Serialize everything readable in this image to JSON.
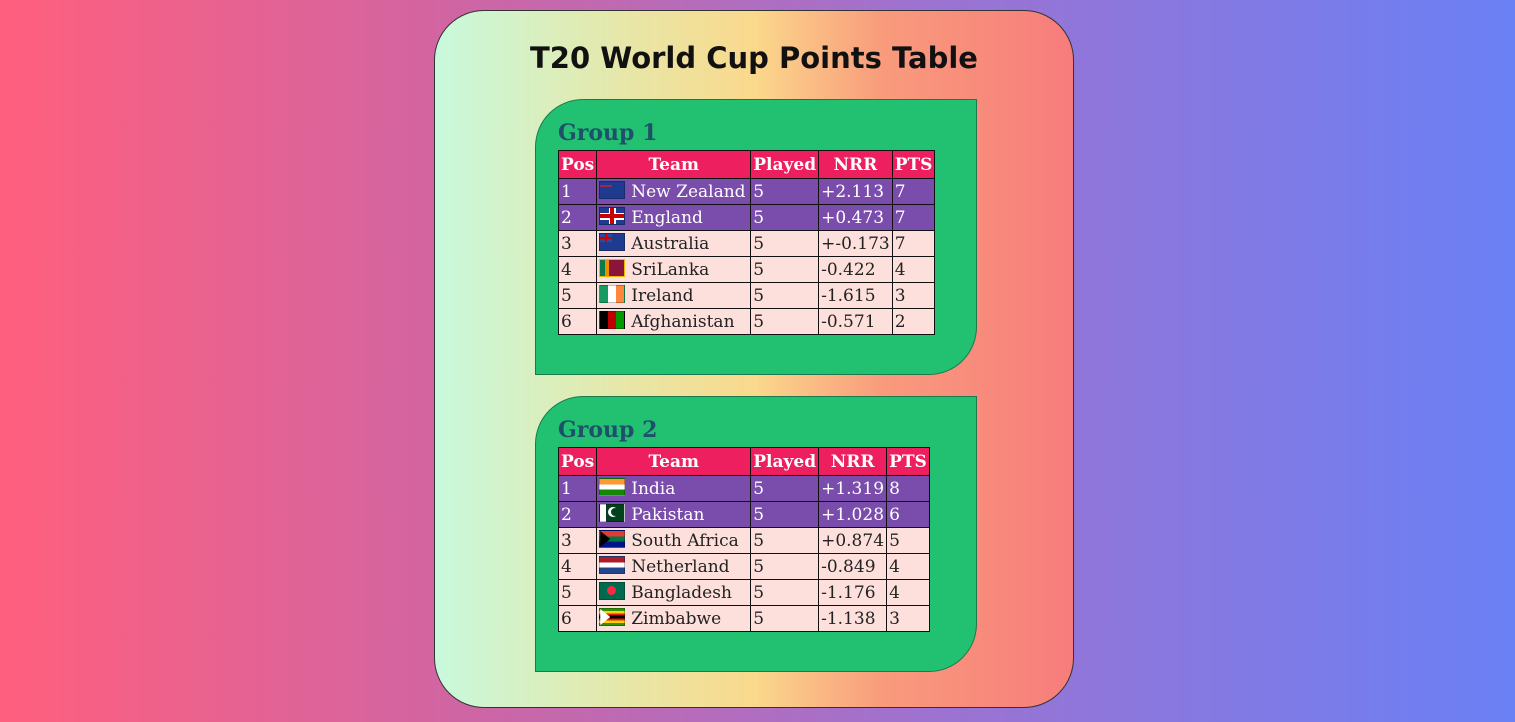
{
  "page": {
    "title": "T20 World Cup Points Table"
  },
  "columns": {
    "pos": "Pos",
    "team": "Team",
    "played": "Played",
    "nrr": "NRR",
    "pts": "PTS"
  },
  "groups": [
    {
      "title": "Group 1",
      "rows": [
        {
          "pos": "1",
          "team": "New Zealand",
          "flag": "flag-new-zealand",
          "played": "5",
          "nrr": "+2.113",
          "pts": "7"
        },
        {
          "pos": "2",
          "team": "England",
          "flag": "flag-england",
          "played": "5",
          "nrr": "+0.473",
          "pts": "7"
        },
        {
          "pos": "3",
          "team": "Australia",
          "flag": "flag-australia",
          "played": "5",
          "nrr": "+-0.173",
          "pts": "7"
        },
        {
          "pos": "4",
          "team": "SriLanka",
          "flag": "flag-sri-lanka",
          "played": "5",
          "nrr": "-0.422",
          "pts": "4"
        },
        {
          "pos": "5",
          "team": "Ireland",
          "flag": "flag-ireland",
          "played": "5",
          "nrr": "-1.615",
          "pts": "3"
        },
        {
          "pos": "6",
          "team": "Afghanistan",
          "flag": "flag-afghanistan",
          "played": "5",
          "nrr": "-0.571",
          "pts": "2"
        }
      ]
    },
    {
      "title": "Group 2",
      "rows": [
        {
          "pos": "1",
          "team": "India",
          "flag": "flag-india",
          "played": "5",
          "nrr": "+1.319",
          "pts": "8"
        },
        {
          "pos": "2",
          "team": "Pakistan",
          "flag": "flag-pakistan",
          "played": "5",
          "nrr": "+1.028",
          "pts": "6"
        },
        {
          "pos": "3",
          "team": "South Africa",
          "flag": "flag-south-africa",
          "played": "5",
          "nrr": "+0.874",
          "pts": "5"
        },
        {
          "pos": "4",
          "team": "Netherland",
          "flag": "flag-netherlands",
          "played": "5",
          "nrr": "-0.849",
          "pts": "4"
        },
        {
          "pos": "5",
          "team": "Bangladesh",
          "flag": "flag-bangladesh",
          "played": "5",
          "nrr": "-1.176",
          "pts": "4"
        },
        {
          "pos": "6",
          "team": "Zimbabwe",
          "flag": "flag-zimbabwe",
          "played": "5",
          "nrr": "-1.138",
          "pts": "3"
        }
      ]
    }
  ],
  "colors": {
    "header": "#ee1f5f",
    "qualified_row": "#7a4cab",
    "normal_row": "#fde0dc",
    "group_panel": "#22c172",
    "group_title": "#1f4f6a"
  }
}
